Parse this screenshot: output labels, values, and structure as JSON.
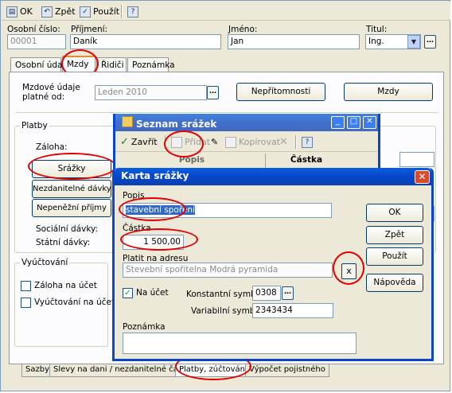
{
  "toolbar": {
    "ok": "OK",
    "back": "Zpět",
    "use": "Použít",
    "help": "?"
  },
  "header": {
    "personal_number_label": "Osobní číslo:",
    "personal_number": "00001",
    "surname_label": "Příjmení:",
    "surname": "Daník",
    "firstname_label": "Jméno:",
    "firstname": "Jan",
    "title_label": "Titul:",
    "title": "Ing."
  },
  "tabs": [
    "Osobní údaje",
    "Mzdy",
    "Řidiči",
    "Poznámka"
  ],
  "mzdy": {
    "period_label_1": "Mzdové údaje",
    "period_label_2": "platné od:",
    "period": "Leden 2010",
    "absences_button": "Nepřítomnosti",
    "wages_button": "Mzdy"
  },
  "platby": {
    "group_label": "Platby",
    "advance_label": "Záloha:",
    "deductions_button": "Srážky",
    "nontaxable_button": "Nezdanitelné dávky",
    "noncash_button": "Nepeněžní příjmy",
    "social_label": "Sociální dávky:",
    "state_label": "Státní dávky:"
  },
  "vyuctovani": {
    "group_label": "Vyúčtování",
    "advance_check": "Záloha na účet",
    "settlement_check": "Vyúčtování na účet"
  },
  "bottom_tabs": [
    "Sazby",
    "Slevy na dani / nezdanitelné částky",
    "Platby, zúčtování",
    "Výpočet pojistného"
  ],
  "seznam": {
    "title": "Seznam srážek",
    "close": "Zavřít",
    "add": "Přidat",
    "copy": "Kopírovat",
    "help": "?",
    "col_desc": "Popis",
    "col_amount": "Částka"
  },
  "karta": {
    "title": "Karta srážky",
    "desc_label": "Popis",
    "desc": "stavební spoření",
    "amount_label": "Částka",
    "amount": "1 500,00",
    "address_label": "Platit na adresu",
    "address": "Stevební spořitelna Modrá pyramida",
    "account_check": "Na účet",
    "const_label": "Konstantní symbol:",
    "const_value": "0308",
    "var_label": "Variabilní symbol:",
    "var_value": "2343434",
    "note_label": "Poznámka",
    "ok": "OK",
    "back": "Zpět",
    "use": "Použít",
    "help": "Nápověda",
    "clear": "x"
  }
}
